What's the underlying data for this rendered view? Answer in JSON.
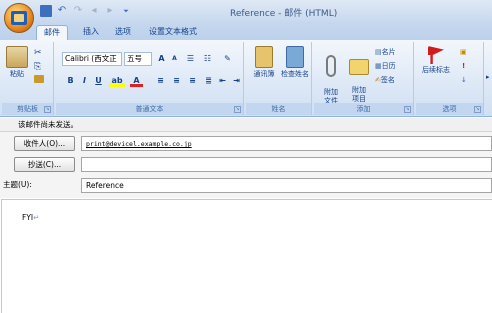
{
  "window": {
    "title": "Reference - 邮件 (HTML)"
  },
  "qat": {
    "save_icon": "💾",
    "undo_icon": "↶",
    "redo_icon": "↷",
    "back_icon": "◂",
    "forward_icon": "▸",
    "customize_icon": "⏷"
  },
  "tabs": [
    {
      "label": "邮件",
      "active": true
    },
    {
      "label": "插入",
      "active": false
    },
    {
      "label": "选项",
      "active": false
    },
    {
      "label": "设置文本格式",
      "active": false
    }
  ],
  "ribbon": {
    "clipboard": {
      "label": "剪贴板",
      "paste": "粘贴",
      "cut_icon": "✂",
      "copy_icon": "⎘",
      "painter_icon": "🖌"
    },
    "font": {
      "label": "普通文本",
      "font_name": "Calibri (西文正",
      "font_size": "五号",
      "grow": "A",
      "shrink": "A",
      "bold": "B",
      "italic": "I",
      "underline": "U",
      "highlight": "ab",
      "font_color": "A"
    },
    "names": {
      "label": "姓名",
      "address_book": "通讯簿",
      "check_names": "检查姓名"
    },
    "include": {
      "label": "添加",
      "attach_file": "附加\n文件",
      "attach_item": "附加\n项目",
      "business_card": "名片",
      "calendar": "日历",
      "signature": "签名"
    },
    "options": {
      "label": "选项",
      "follow_up": "后续标志",
      "importance_high": "!",
      "importance_low": "↓"
    },
    "colors": {
      "accent": "#15428b",
      "ribbon_bg": "#dde8f6",
      "flag": "#d21b1b"
    }
  },
  "message": {
    "infobar": "该邮件尚未发送。",
    "to_button": "收件人(O)...",
    "to_value": "print@devicel.example.co.jp",
    "cc_button": "抄送(C)...",
    "cc_value": "",
    "subject_label": "主题(U):",
    "subject_value": "Reference",
    "body": "FYI"
  }
}
